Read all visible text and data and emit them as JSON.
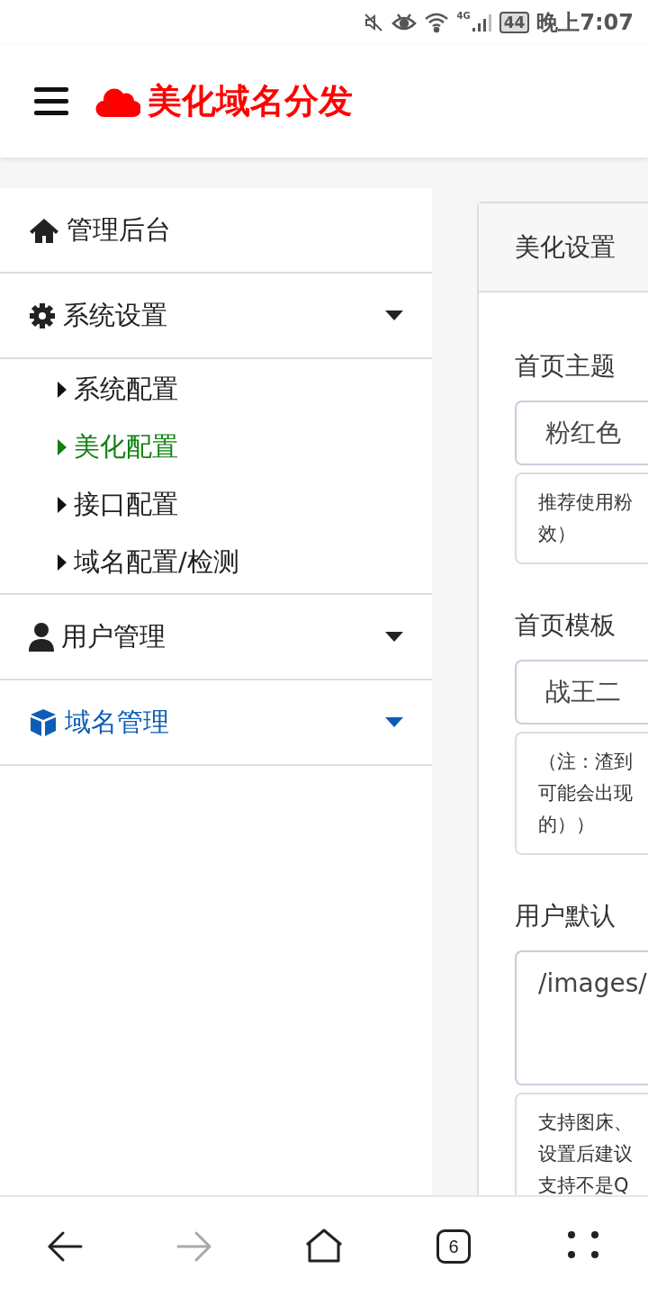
{
  "status_bar": {
    "network": "4G",
    "battery": "44",
    "time": "晚上7:07"
  },
  "header": {
    "title": "美化域名分发"
  },
  "sidebar": {
    "items": [
      {
        "label": "管理后台",
        "kind": "link",
        "selected": false
      },
      {
        "label": "系统设置",
        "kind": "group",
        "selected": false,
        "expanded": true,
        "children": [
          {
            "label": "系统配置",
            "selected": false
          },
          {
            "label": "美化配置",
            "selected": true
          },
          {
            "label": "接口配置",
            "selected": false
          },
          {
            "label": "域名配置/检测",
            "selected": false
          }
        ]
      },
      {
        "label": "用户管理",
        "kind": "group",
        "selected": false
      },
      {
        "label": "域名管理",
        "kind": "group",
        "selected": true
      }
    ]
  },
  "panel": {
    "title": "美化设置",
    "fields": [
      {
        "label": "首页主题",
        "kind": "select",
        "value": "粉红色",
        "hint": [
          "推荐使用粉",
          "效）"
        ]
      },
      {
        "label": "首页模板",
        "kind": "select",
        "value": "战王二",
        "hint": [
          "（注：渣到",
          "可能会出现",
          "的））"
        ]
      },
      {
        "label": "用户默认",
        "kind": "textarea",
        "value": "/images/",
        "hint": [
          "支持图床、",
          "设置后建议",
          "支持不是Q"
        ]
      }
    ]
  },
  "bottom_nav": {
    "tab_count": "6",
    "forward_disabled": true
  }
}
